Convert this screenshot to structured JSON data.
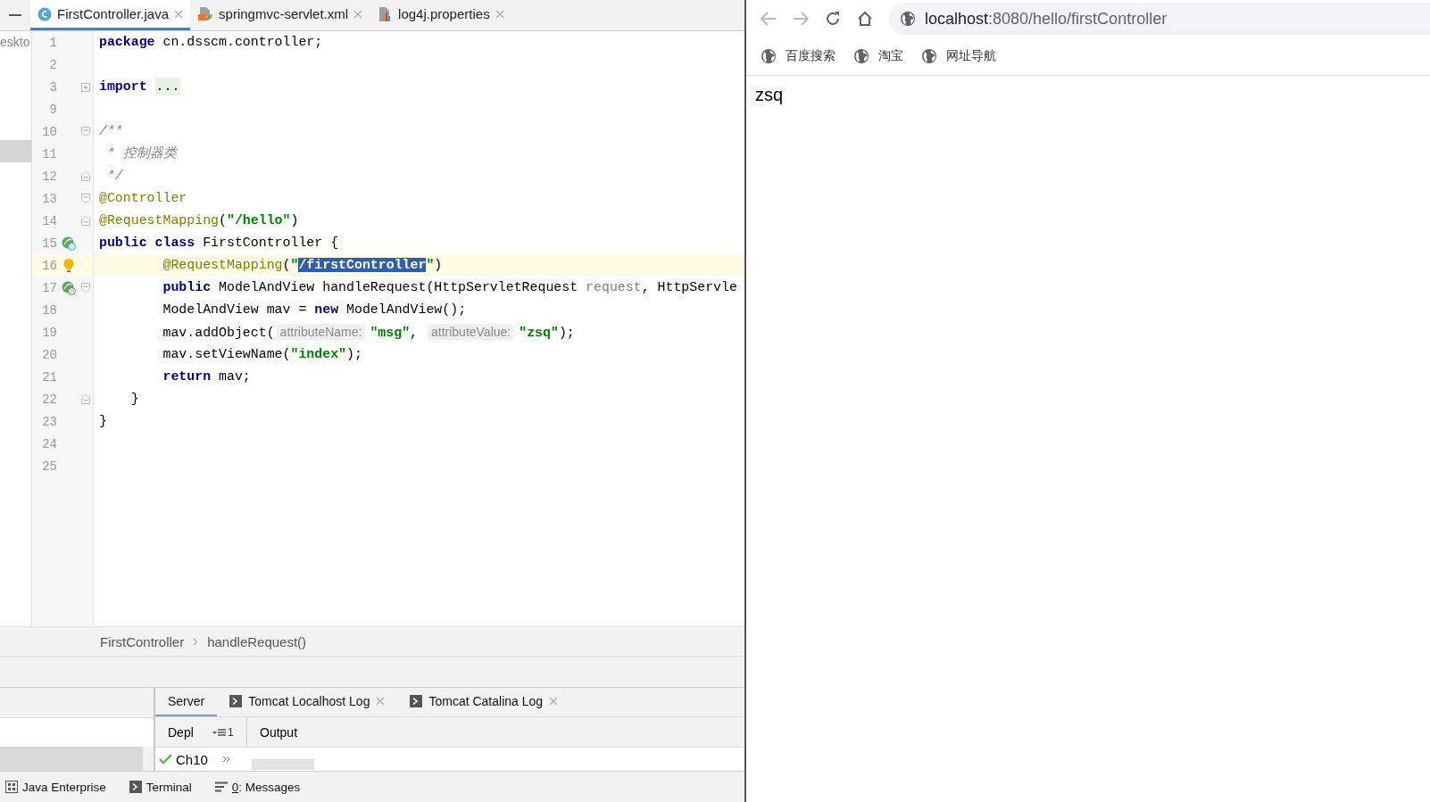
{
  "ide": {
    "tabs": [
      {
        "label": "FirstController.java",
        "kind": "java",
        "selected": true
      },
      {
        "label": "springmvc-servlet.xml",
        "kind": "xml",
        "selected": false
      },
      {
        "label": "log4j.properties",
        "kind": "properties",
        "selected": false
      }
    ],
    "project_label": "eskto",
    "lines": [
      {
        "number": "1",
        "current": false,
        "tokens": [
          {
            "kind": "kw",
            "text": "package"
          },
          {
            "kind": "plain",
            "text": " cn.dsscm.controller;"
          }
        ]
      },
      {
        "number": "2",
        "current": false
      },
      {
        "number": "3",
        "current": false,
        "fold": {
          "kind": "collapsed"
        },
        "tokens": [
          {
            "kind": "kw",
            "text": "import "
          },
          {
            "kind": "folded",
            "text": "..."
          }
        ]
      },
      {
        "number": "9",
        "current": false
      },
      {
        "number": "10",
        "current": false,
        "fold": {
          "kind": "start"
        },
        "tokens": [
          {
            "kind": "comment",
            "text": "/**"
          }
        ]
      },
      {
        "number": "11",
        "current": false,
        "tokens": [
          {
            "kind": "comment",
            "text": " * 控制器类"
          }
        ]
      },
      {
        "number": "12",
        "current": false,
        "fold": {
          "kind": "end"
        },
        "tokens": [
          {
            "kind": "comment",
            "text": " */"
          }
        ]
      },
      {
        "number": "13",
        "current": false,
        "fold": {
          "kind": "start"
        },
        "tokens": [
          {
            "kind": "ann",
            "text": "@Controller"
          }
        ]
      },
      {
        "number": "14",
        "current": false,
        "fold": {
          "kind": "end"
        },
        "tokens": [
          {
            "kind": "ann",
            "text": "@RequestMapping"
          },
          {
            "kind": "plain",
            "text": "("
          },
          {
            "kind": "str",
            "text": "\"/hello\""
          },
          {
            "kind": "plain",
            "text": ")"
          }
        ]
      },
      {
        "number": "15",
        "current": false,
        "marker": {
          "kind": "bean_class"
        },
        "tokens": [
          {
            "kind": "kw",
            "text": "public class"
          },
          {
            "kind": "plain",
            "text": " FirstController {"
          }
        ]
      },
      {
        "number": "16",
        "current": true,
        "marker": {
          "kind": "bulb"
        },
        "tokens": [
          {
            "kind": "ann",
            "text": "        @RequestMapping"
          },
          {
            "kind": "plain",
            "text": "("
          },
          {
            "kind": "str",
            "text": "\""
          },
          {
            "kind": "selected",
            "text": "/firstController"
          },
          {
            "kind": "str",
            "text": "\""
          },
          {
            "kind": "plain",
            "text": ")"
          }
        ]
      },
      {
        "number": "17",
        "current": false,
        "marker": {
          "kind": "bean_method"
        },
        "fold": {
          "kind": "start"
        },
        "tokens": [
          {
            "kind": "kw",
            "text": "        public"
          },
          {
            "kind": "plain",
            "text": " ModelAndView handleRequest(HttpServletRequest "
          },
          {
            "kind": "param",
            "text": "request"
          },
          {
            "kind": "plain",
            "text": ", HttpServle"
          }
        ]
      },
      {
        "number": "18",
        "current": false,
        "tokens": [
          {
            "kind": "plain",
            "text": "        ModelAndView mav = "
          },
          {
            "kind": "kw",
            "text": "new"
          },
          {
            "kind": "plain",
            "text": " ModelAndView();"
          }
        ]
      },
      {
        "number": "19",
        "current": false,
        "tokens": [
          {
            "kind": "plain",
            "text": "        mav.addObject("
          },
          {
            "kind": "hint",
            "text": "attributeName:"
          },
          {
            "kind": "str",
            "text": "\"msg\""
          },
          {
            "kind": "plain",
            "text": ", "
          },
          {
            "kind": "hint",
            "text": "attributeValue:"
          },
          {
            "kind": "str",
            "text": "\"zsq\""
          },
          {
            "kind": "plain",
            "text": ");"
          }
        ]
      },
      {
        "number": "20",
        "current": false,
        "tokens": [
          {
            "kind": "plain",
            "text": "        mav.setViewName("
          },
          {
            "kind": "str",
            "text": "\"index\""
          },
          {
            "kind": "plain",
            "text": ");"
          }
        ]
      },
      {
        "number": "21",
        "current": false,
        "tokens": [
          {
            "kind": "kw",
            "text": "        return"
          },
          {
            "kind": "plain",
            "text": " mav;"
          }
        ]
      },
      {
        "number": "22",
        "current": false,
        "fold": {
          "kind": "end"
        },
        "tokens": [
          {
            "kind": "plain",
            "text": "    }"
          }
        ]
      },
      {
        "number": "23",
        "current": false,
        "tokens": [
          {
            "kind": "plain",
            "text": "}"
          }
        ]
      },
      {
        "number": "24",
        "current": false
      },
      {
        "number": "25",
        "current": false
      }
    ],
    "breadcrumb": [
      "FirstController",
      "handleRequest()"
    ],
    "services": {
      "tabs": [
        {
          "label": "Server",
          "console": false,
          "closable": false,
          "selected": true
        },
        {
          "label": "Tomcat Localhost Log",
          "console": true,
          "closable": true,
          "selected": false
        },
        {
          "label": "Tomcat Catalina Log",
          "console": true,
          "closable": true,
          "selected": false
        }
      ],
      "deploy_header": "Depl",
      "deploy_count": "1",
      "output_header": "Output",
      "deployment": {
        "label": "Ch10",
        "ok": true
      }
    },
    "tool_windows": [
      {
        "kind": "javaee",
        "label": "Java Enterprise"
      },
      {
        "kind": "terminal",
        "label": "Terminal"
      },
      {
        "kind": "messages",
        "mnemonic": "0",
        "label": ": Messages"
      }
    ]
  },
  "browser": {
    "url": {
      "host": "localhost",
      "path": ":8080/hello/firstController"
    },
    "bookmarks": [
      "百度搜索",
      "淘宝",
      "网址导航"
    ],
    "page_text": "zsq"
  }
}
